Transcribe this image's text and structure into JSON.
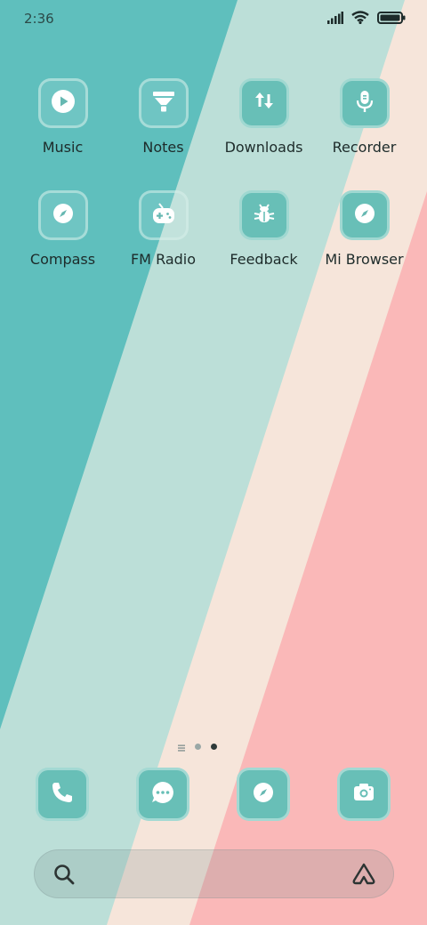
{
  "status_bar": {
    "time": "2:36",
    "icons": [
      "signal-icon",
      "wifi-icon",
      "battery-icon"
    ]
  },
  "apps": [
    {
      "label": "Music",
      "icon": "play-icon",
      "style": "outline"
    },
    {
      "label": "Notes",
      "icon": "notes-icon",
      "style": "outline"
    },
    {
      "label": "Downloads",
      "icon": "download-icon",
      "style": "solid"
    },
    {
      "label": "Recorder",
      "icon": "microphone-icon",
      "style": "solid"
    },
    {
      "label": "Compass",
      "icon": "compass-icon",
      "style": "outline"
    },
    {
      "label": "FM Radio",
      "icon": "radio-icon",
      "style": "outline"
    },
    {
      "label": "Feedback",
      "icon": "bug-icon",
      "style": "solid"
    },
    {
      "label": "Mi Browser",
      "icon": "compass-icon",
      "style": "solid"
    }
  ],
  "page_indicator": {
    "pages": 3,
    "current": 3
  },
  "dock": [
    {
      "icon": "phone-icon"
    },
    {
      "icon": "message-icon"
    },
    {
      "icon": "compass-icon"
    },
    {
      "icon": "camera-icon"
    }
  ],
  "search": {
    "icon": "search-icon",
    "assistant_icon": "assistant-icon"
  },
  "colors": {
    "teal": "#5fbfbd",
    "mint": "#bcdfd8",
    "cream": "#f6e5da",
    "pink": "#fab8b8",
    "icon_tile": "#68bfb7"
  }
}
